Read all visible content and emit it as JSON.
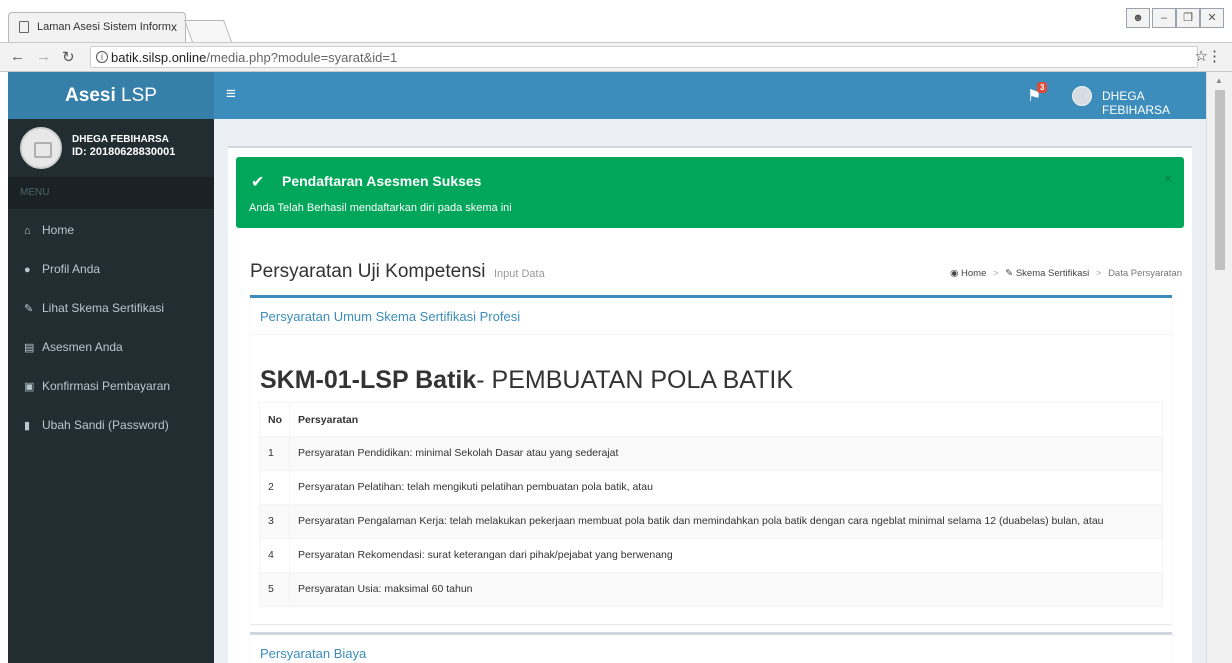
{
  "browser": {
    "tab_title": "Laman Asesi Sistem Inform",
    "tab_close": "x",
    "url_domain": "batik.silsp.online",
    "url_path": "/media.php?module=syarat&id=1"
  },
  "app": {
    "logo_bold": "Asesi",
    "logo_rest": " LSP",
    "notification_count": "3",
    "user_name": "DHEGA FEBIHARSA"
  },
  "sidebar": {
    "name": "DHEGA FEBIHARSA",
    "id_text": "ID: 20180628830001",
    "menu_header": "MENU",
    "items": [
      {
        "label": "Home",
        "icon": "home-icon"
      },
      {
        "label": "Profil Anda",
        "icon": "user-icon"
      },
      {
        "label": "Lihat Skema Sertifikasi",
        "icon": "edit-icon"
      },
      {
        "label": "Asesmen Anda",
        "icon": "document-icon"
      },
      {
        "label": "Konfirmasi Pembayaran",
        "icon": "money-icon"
      },
      {
        "label": "Ubah Sandi (Password)",
        "icon": "lock-icon"
      }
    ]
  },
  "alert": {
    "title": "Pendaftaran Asesmen Sukses",
    "message": "Anda Telah Berhasil mendaftarkan diri pada skema ini",
    "close": "×"
  },
  "page": {
    "title": "Persyaratan Uji Kompetensi",
    "subtitle": "Input Data"
  },
  "breadcrumb": {
    "home": "Home",
    "skema": "Skema Sertifikasi",
    "current": "Data Persyaratan"
  },
  "box1": {
    "header": "Persyaratan Umum Skema Sertifikasi Profesi",
    "schema_code": "SKM-01-LSP Batik",
    "schema_name": "- PEMBUATAN POLA BATIK",
    "table": {
      "col_no": "No",
      "col_req": "Persyaratan",
      "rows": [
        {
          "no": "1",
          "text": "Persyaratan Pendidikan: minimal Sekolah Dasar atau yang sederajat"
        },
        {
          "no": "2",
          "text": "Persyaratan Pelatihan: telah mengikuti pelatihan pembuatan pola batik, atau"
        },
        {
          "no": "3",
          "text": "Persyaratan Pengalaman Kerja: telah melakukan pekerjaan membuat pola batik dan memindahkan pola batik dengan cara ngeblat minimal selama 12 (duabelas) bulan, atau"
        },
        {
          "no": "4",
          "text": "Persyaratan Rekomendasi: surat keterangan dari pihak/pejabat yang berwenang"
        },
        {
          "no": "5",
          "text": "Persyaratan Usia: maksimal 60 tahun"
        }
      ]
    }
  },
  "box2": {
    "header": "Persyaratan Biaya"
  },
  "colors": {
    "primary": "#3c8dbc",
    "logo_bg": "#367fa9",
    "sidebar_bg": "#222d32",
    "success": "#00a65a",
    "content_bg": "#ecf0f5"
  }
}
